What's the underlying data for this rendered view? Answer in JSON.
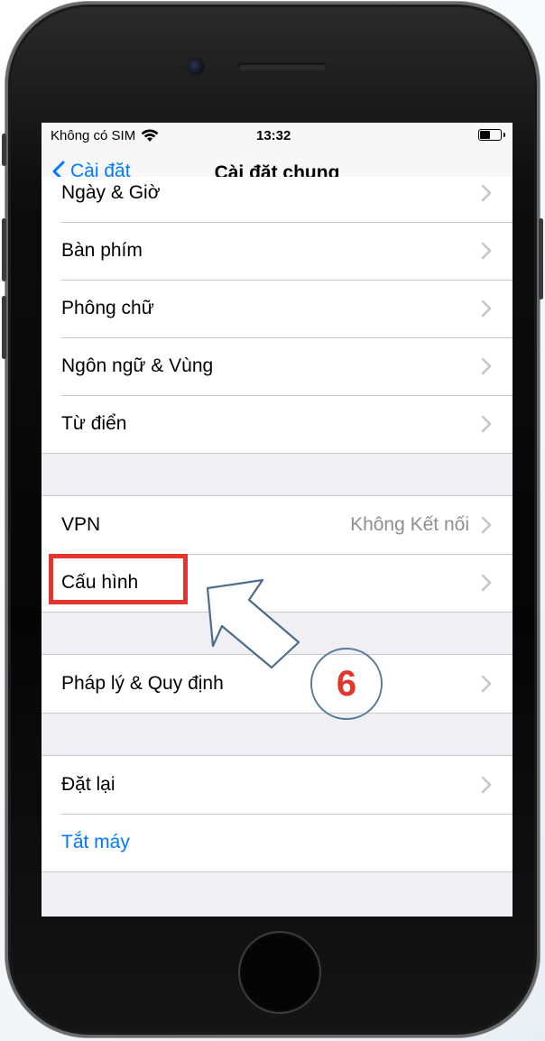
{
  "status_bar": {
    "carrier": "Không có SIM",
    "time": "13:32"
  },
  "nav": {
    "back_label": "Cài đặt",
    "title": "Cài đặt chung"
  },
  "groups": [
    {
      "rows": [
        {
          "label": "Ngày & Giờ",
          "partial": true
        },
        {
          "label": "Bàn phím"
        },
        {
          "label": "Phông chữ"
        },
        {
          "label": "Ngôn ngữ & Vùng"
        },
        {
          "label": "Từ điển"
        }
      ]
    },
    {
      "rows": [
        {
          "label": "VPN",
          "detail": "Không Kết nối"
        },
        {
          "label": "Cấu hình"
        }
      ]
    },
    {
      "rows": [
        {
          "label": "Pháp lý & Quy định"
        }
      ]
    },
    {
      "rows": [
        {
          "label": "Đặt lại"
        },
        {
          "label": "Tắt máy",
          "style": "blue"
        }
      ]
    }
  ],
  "annotation": {
    "step_number": "6",
    "highlight_color": "#e5342b",
    "ios_blue": "#007aff"
  }
}
